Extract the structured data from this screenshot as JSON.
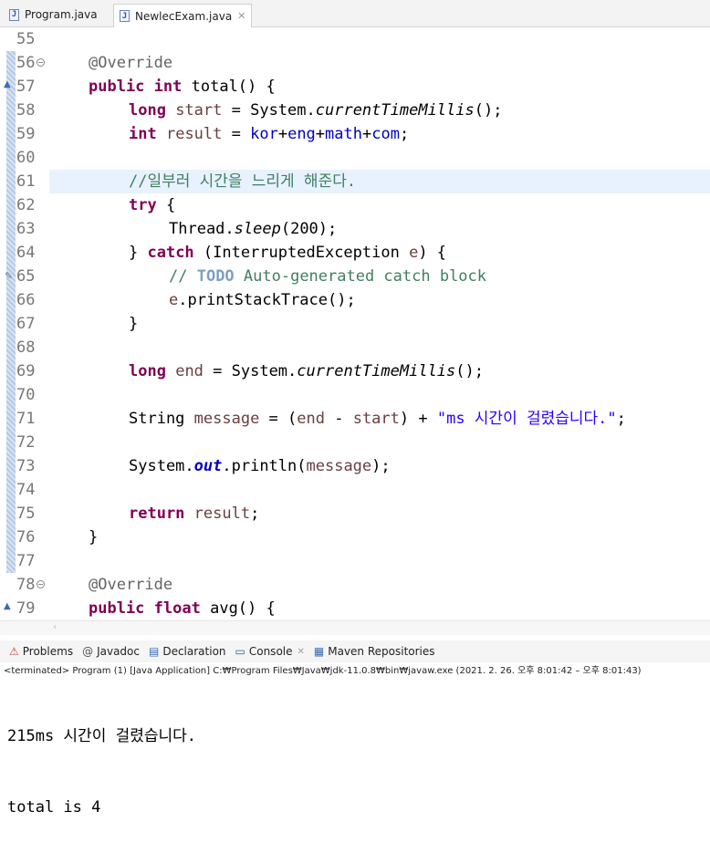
{
  "editor_tabs": [
    {
      "label": "Program.java",
      "icon": "java-file-icon",
      "active": false
    },
    {
      "label": "NewlecExam.java",
      "icon": "java-file-icon",
      "active": true,
      "close": "✕"
    }
  ],
  "lines": [
    {
      "num": "55"
    },
    {
      "num": "56"
    },
    {
      "num": "57"
    },
    {
      "num": "58"
    },
    {
      "num": "59"
    },
    {
      "num": "60"
    },
    {
      "num": "61"
    },
    {
      "num": "62"
    },
    {
      "num": "63"
    },
    {
      "num": "64"
    },
    {
      "num": "65"
    },
    {
      "num": "66"
    },
    {
      "num": "67"
    },
    {
      "num": "68"
    },
    {
      "num": "69"
    },
    {
      "num": "70"
    },
    {
      "num": "71"
    },
    {
      "num": "72"
    },
    {
      "num": "73"
    },
    {
      "num": "74"
    },
    {
      "num": "75"
    },
    {
      "num": "76"
    },
    {
      "num": "77"
    },
    {
      "num": "78"
    },
    {
      "num": "79"
    }
  ],
  "code": {
    "l56": "@Override",
    "l57_kw1": "public",
    "l57_kw2": "int",
    "l57_rest": " total() {",
    "l58_kw": "long",
    "l58_var": "start",
    "l58_mid": " = System.",
    "l58_method": "currentTimeMillis",
    "l58_end": "();",
    "l59_kw": "int",
    "l59_var": "result",
    "l59_eq": " = ",
    "l59_f1": "kor",
    "l59_f2": "eng",
    "l59_f3": "math",
    "l59_f4": "com",
    "l59_end": ";",
    "l61_comment": "//일부러 시간을 느리게 해준다.",
    "l62_kw": "try",
    "l62_rest": " {",
    "l63_a": "Thread.",
    "l63_method": "sleep",
    "l63_b": "(200);",
    "l64_a": "} ",
    "l64_kw": "catch",
    "l64_b": " (InterruptedException ",
    "l64_var": "e",
    "l64_c": ") {",
    "l65_c1": "// ",
    "l65_todo": "TODO",
    "l65_c2": " Auto-generated catch block",
    "l66_var": "e",
    "l66_rest": ".printStackTrace();",
    "l67": "}",
    "l69_kw": "long",
    "l69_var": "end",
    "l69_mid": " = System.",
    "l69_method": "currentTimeMillis",
    "l69_end": "();",
    "l71_a": "String ",
    "l71_var": "message",
    "l71_b": " = (",
    "l71_v1": "end",
    "l71_c": " - ",
    "l71_v2": "start",
    "l71_d": ") + ",
    "l71_str": "\"ms 시간이 걸렸습니다.\"",
    "l71_end": ";",
    "l73_a": "System.",
    "l73_field": "out",
    "l73_b": ".println(",
    "l73_var": "message",
    "l73_c": ");",
    "l75_kw": "return",
    "l75_var": "result",
    "l75_end": ";",
    "l76": "}",
    "l78": "@Override",
    "l79_kw1": "public",
    "l79_kw2": "float",
    "l79_rest": " avg() {"
  },
  "views": [
    {
      "label": "Problems",
      "icon": "problems-icon"
    },
    {
      "label": "Javadoc",
      "icon": "javadoc-icon"
    },
    {
      "label": "Declaration",
      "icon": "declaration-icon"
    },
    {
      "label": "Console",
      "icon": "console-icon",
      "active": true,
      "close": "✕"
    },
    {
      "label": "Maven Repositories",
      "icon": "maven-icon"
    }
  ],
  "console": {
    "status": "<terminated> Program (1) [Java Application] C:₩Program Files₩Java₩jdk-11.0.8₩bin₩javaw.exe  (2021. 2. 26. 오후 8:01:42 – 오후 8:01:43)",
    "output_line1": "215ms 시간이 걸렸습니다.",
    "output_line2": "total is 4"
  },
  "colors": {
    "keyword": "#7f0055",
    "string": "#2a00ff",
    "comment": "#3f7f5f",
    "field": "#0000c0",
    "local_var": "#6a3e3e",
    "current_line": "#e8f2fe"
  }
}
